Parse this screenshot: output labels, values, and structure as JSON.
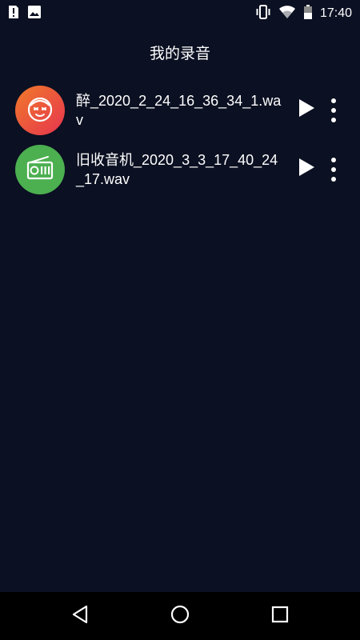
{
  "status_bar": {
    "time": "17:40",
    "left_icons": [
      "sim-alert-icon",
      "image-icon"
    ],
    "right_icons": [
      "vibrate-icon",
      "wifi-icon",
      "battery-icon"
    ]
  },
  "header": {
    "title": "我的录音"
  },
  "recordings": [
    {
      "file_name": "醉_2020_2_24_16_36_34_1.wav",
      "avatar_icon": "face-icon",
      "avatar_color": "#ee5a37",
      "play_icon": "play-icon",
      "more_icon": "more-vert-icon"
    },
    {
      "file_name": "旧收音机_2020_3_3_17_40_24_17.wav",
      "avatar_icon": "radio-icon",
      "avatar_color": "#4caf50",
      "play_icon": "play-icon",
      "more_icon": "more-vert-icon"
    }
  ],
  "nav_bar": {
    "icons": [
      "back-icon",
      "home-icon",
      "recents-icon"
    ]
  },
  "colors": {
    "background": "#0b1022",
    "nav_background": "#000000",
    "text": "#ffffff"
  }
}
